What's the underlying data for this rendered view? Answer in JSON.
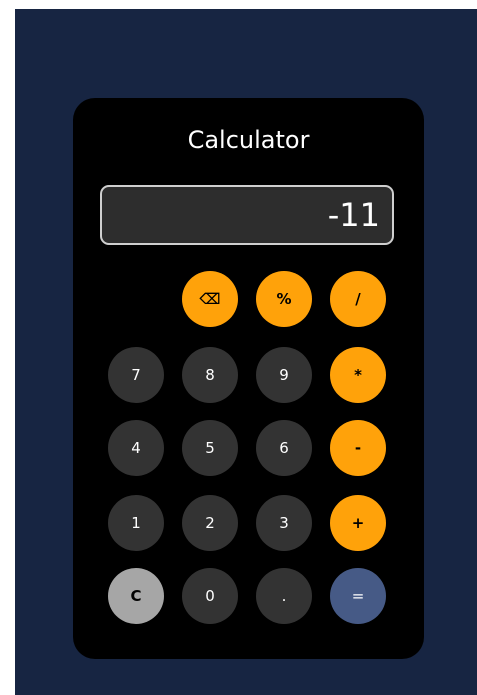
{
  "title": "Calculator",
  "display": {
    "value": "-11"
  },
  "keys": {
    "backspace": "⌫",
    "percent": "%",
    "divide": "/",
    "seven": "7",
    "eight": "8",
    "nine": "9",
    "multiply": "*",
    "four": "4",
    "five": "5",
    "six": "6",
    "subtract": "-",
    "one": "1",
    "two": "2",
    "three": "3",
    "add": "+",
    "clear": "C",
    "zero": "0",
    "decimal": ".",
    "equals": "="
  },
  "colors": {
    "page_background": "#172542",
    "calculator_body": "#000000",
    "number_key": "#333333",
    "operator_key": "#ffa20a",
    "clear_key": "#a6a6a6",
    "equals_key": "#465a86"
  }
}
